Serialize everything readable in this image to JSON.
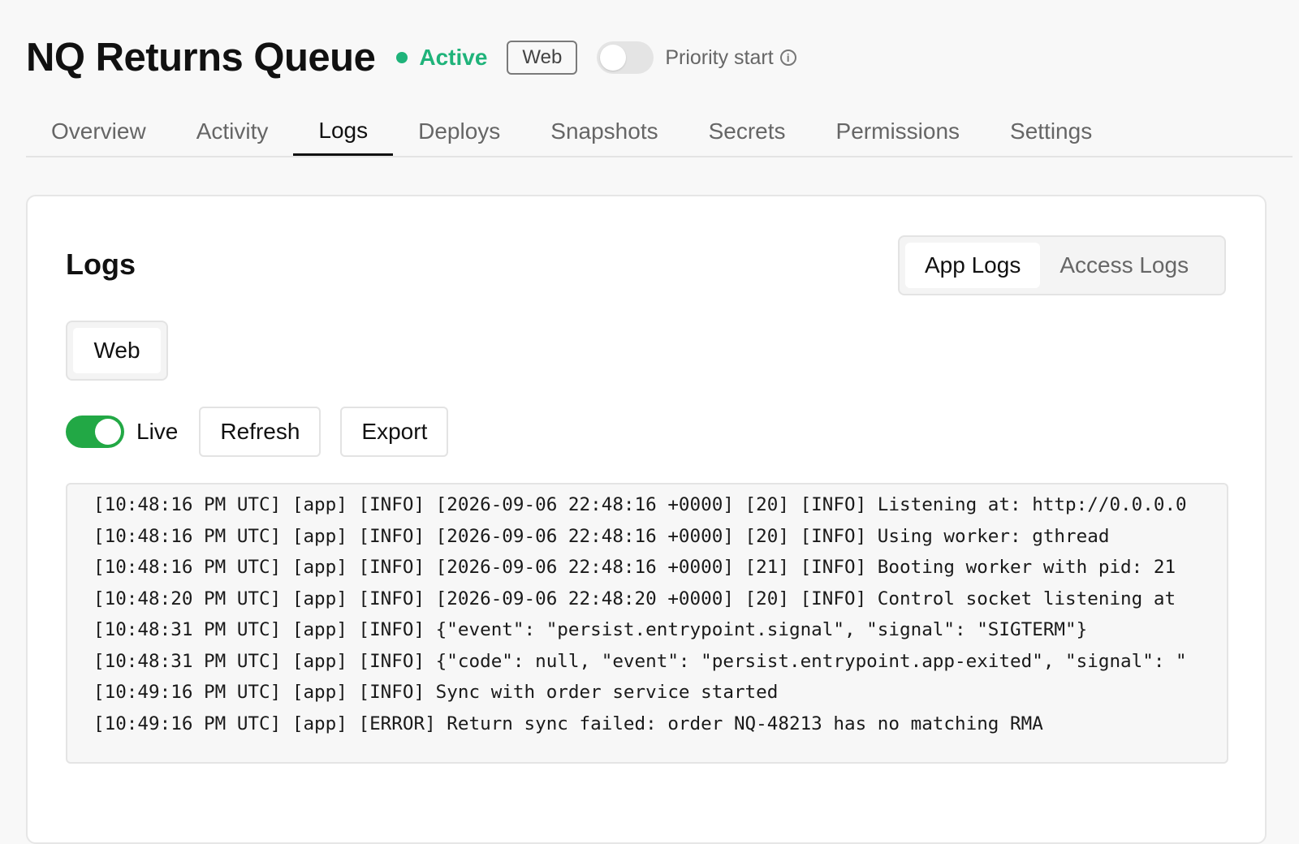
{
  "header": {
    "title": "NQ Returns Queue",
    "status": "Active",
    "badge": "Web",
    "priority_label": "Priority start",
    "priority_enabled": false
  },
  "tabs": [
    {
      "label": "Overview",
      "active": false
    },
    {
      "label": "Activity",
      "active": false
    },
    {
      "label": "Logs",
      "active": true
    },
    {
      "label": "Deploys",
      "active": false
    },
    {
      "label": "Snapshots",
      "active": false
    },
    {
      "label": "Secrets",
      "active": false
    },
    {
      "label": "Permissions",
      "active": false
    },
    {
      "label": "Settings",
      "active": false
    }
  ],
  "panel": {
    "title": "Logs",
    "log_types": [
      "App Logs",
      "Access Logs"
    ],
    "selected_log_type": "App Logs",
    "process_filter": "Web",
    "live_label": "Live",
    "live_enabled": true,
    "refresh_label": "Refresh",
    "export_label": "Export"
  },
  "logs": [
    "[10:48:16 PM UTC] [app] [INFO] [2026-09-06 22:48:16 +0000] [20] [INFO] Listening at: http://0.0.0.0",
    "[10:48:16 PM UTC] [app] [INFO] [2026-09-06 22:48:16 +0000] [20] [INFO] Using worker: gthread",
    "[10:48:16 PM UTC] [app] [INFO] [2026-09-06 22:48:16 +0000] [21] [INFO] Booting worker with pid: 21",
    "[10:48:20 PM UTC] [app] [INFO] [2026-09-06 22:48:20 +0000] [20] [INFO] Control socket listening at",
    "[10:48:31 PM UTC] [app] [INFO] {\"event\": \"persist.entrypoint.signal\", \"signal\": \"SIGTERM\"}",
    "[10:48:31 PM UTC] [app] [INFO] {\"code\": null, \"event\": \"persist.entrypoint.app-exited\", \"signal\": \"",
    "[10:49:16 PM UTC] [app] [INFO] Sync with order service started",
    "[10:49:16 PM UTC] [app] [ERROR] Return sync failed: order NQ-48213 has no matching RMA"
  ],
  "colors": {
    "status_active": "#1fb37a",
    "toggle_on": "#22a845"
  },
  "icons": {
    "status": "status-dot-icon",
    "info": "info-icon"
  }
}
